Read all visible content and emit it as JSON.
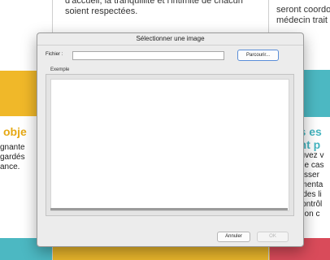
{
  "background": {
    "top_text_left": [
      "d'accueil, la tranquillité et l'intimité de chacun",
      "soient respectées."
    ],
    "top_text_right": [
      "seront coordo",
      "médecin trait"
    ],
    "heading_left": "obje",
    "heading_right": [
      "us es",
      "ont p"
    ],
    "left_col": [
      "gnante",
      "gardés",
      "ance."
    ],
    "right_col": [
      "ouvez v",
      "n le cas",
      "blisser",
      "ementa",
      "e des li",
      "Contrôl",
      "ation c"
    ]
  },
  "dialog": {
    "title": "Sélectionner une image",
    "file_label": "Fichier :",
    "file_value": "",
    "browse_label": "Parcourir...",
    "example_label": "Exemple",
    "cancel_label": "Annuler",
    "ok_label": "OK"
  }
}
